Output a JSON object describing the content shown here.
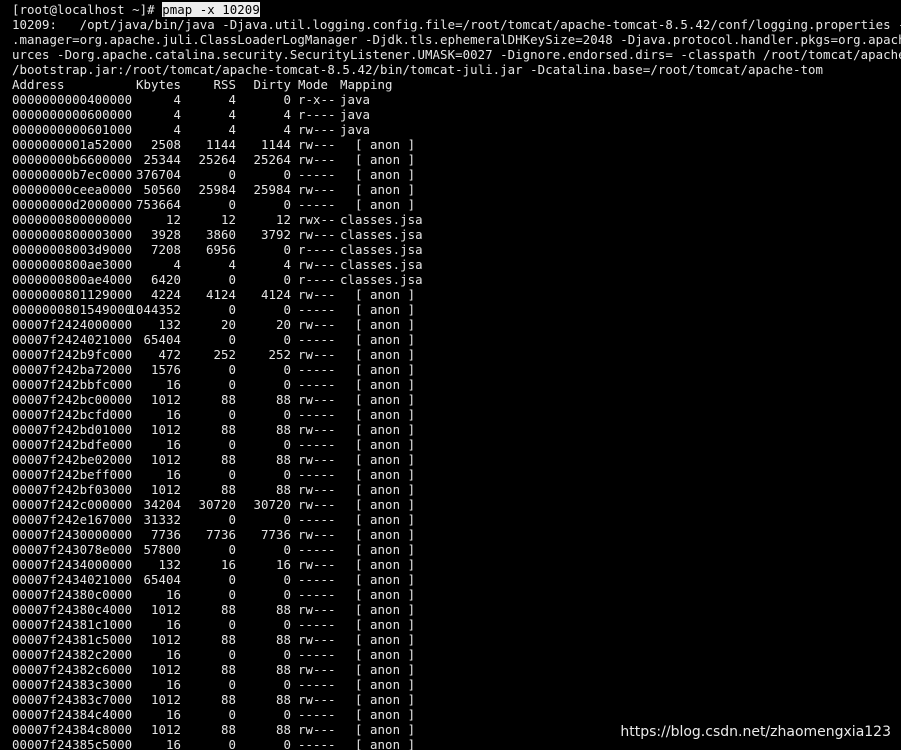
{
  "terminal": {
    "prompt": "[root@localhost ~]# ",
    "command": "pmap -x 10209",
    "info_lines": [
      "10209:   /opt/java/bin/java -Djava.util.logging.config.file=/root/tomcat/apache-tomcat-8.5.42/conf/logging.properties -Djava.ut",
      ".manager=org.apache.juli.ClassLoaderLogManager -Djdk.tls.ephemeralDHKeySize=2048 -Djava.protocol.handler.pkgs=org.apache.catali",
      "urces -Dorg.apache.catalina.security.SecurityListener.UMASK=0027 -Dignore.endorsed.dirs= -classpath /root/tomcat/apache-tomcat-",
      "/bootstrap.jar:/root/tomcat/apache-tomcat-8.5.42/bin/tomcat-juli.jar -Dcatalina.base=/root/tomcat/apache-tom"
    ],
    "headers": {
      "address": "Address",
      "kbytes": "Kbytes",
      "rss": "RSS",
      "dirty": "Dirty",
      "mode": "Mode",
      "mapping": "Mapping"
    },
    "rows": [
      {
        "address": "0000000000400000",
        "kbytes": "4",
        "rss": "4",
        "dirty": "0",
        "mode": "r-x--",
        "mapping": "java"
      },
      {
        "address": "0000000000600000",
        "kbytes": "4",
        "rss": "4",
        "dirty": "4",
        "mode": "r----",
        "mapping": "java"
      },
      {
        "address": "0000000000601000",
        "kbytes": "4",
        "rss": "4",
        "dirty": "4",
        "mode": "rw---",
        "mapping": "java"
      },
      {
        "address": "0000000001a52000",
        "kbytes": "2508",
        "rss": "1144",
        "dirty": "1144",
        "mode": "rw---",
        "mapping": "  [ anon ]"
      },
      {
        "address": "00000000b6600000",
        "kbytes": "25344",
        "rss": "25264",
        "dirty": "25264",
        "mode": "rw---",
        "mapping": "  [ anon ]"
      },
      {
        "address": "00000000b7ec0000",
        "kbytes": "376704",
        "rss": "0",
        "dirty": "0",
        "mode": "-----",
        "mapping": "  [ anon ]"
      },
      {
        "address": "00000000ceea0000",
        "kbytes": "50560",
        "rss": "25984",
        "dirty": "25984",
        "mode": "rw---",
        "mapping": "  [ anon ]"
      },
      {
        "address": "00000000d2000000",
        "kbytes": "753664",
        "rss": "0",
        "dirty": "0",
        "mode": "-----",
        "mapping": "  [ anon ]"
      },
      {
        "address": "0000000800000000",
        "kbytes": "12",
        "rss": "12",
        "dirty": "12",
        "mode": "rwx--",
        "mapping": "classes.jsa"
      },
      {
        "address": "0000000800003000",
        "kbytes": "3928",
        "rss": "3860",
        "dirty": "3792",
        "mode": "rw---",
        "mapping": "classes.jsa"
      },
      {
        "address": "00000008003d9000",
        "kbytes": "7208",
        "rss": "6956",
        "dirty": "0",
        "mode": "r----",
        "mapping": "classes.jsa"
      },
      {
        "address": "0000000800ae3000",
        "kbytes": "4",
        "rss": "4",
        "dirty": "4",
        "mode": "rw---",
        "mapping": "classes.jsa"
      },
      {
        "address": "0000000800ae4000",
        "kbytes": "6420",
        "rss": "0",
        "dirty": "0",
        "mode": "r----",
        "mapping": "classes.jsa"
      },
      {
        "address": "0000000801129000",
        "kbytes": "4224",
        "rss": "4124",
        "dirty": "4124",
        "mode": "rw---",
        "mapping": "  [ anon ]"
      },
      {
        "address": "0000000801549000",
        "kbytes": "1044352",
        "rss": "0",
        "dirty": "0",
        "mode": "-----",
        "mapping": "  [ anon ]"
      },
      {
        "address": "00007f2424000000",
        "kbytes": "132",
        "rss": "20",
        "dirty": "20",
        "mode": "rw---",
        "mapping": "  [ anon ]"
      },
      {
        "address": "00007f2424021000",
        "kbytes": "65404",
        "rss": "0",
        "dirty": "0",
        "mode": "-----",
        "mapping": "  [ anon ]"
      },
      {
        "address": "00007f242b9fc000",
        "kbytes": "472",
        "rss": "252",
        "dirty": "252",
        "mode": "rw---",
        "mapping": "  [ anon ]"
      },
      {
        "address": "00007f242ba72000",
        "kbytes": "1576",
        "rss": "0",
        "dirty": "0",
        "mode": "-----",
        "mapping": "  [ anon ]"
      },
      {
        "address": "00007f242bbfc000",
        "kbytes": "16",
        "rss": "0",
        "dirty": "0",
        "mode": "-----",
        "mapping": "  [ anon ]"
      },
      {
        "address": "00007f242bc00000",
        "kbytes": "1012",
        "rss": "88",
        "dirty": "88",
        "mode": "rw---",
        "mapping": "  [ anon ]"
      },
      {
        "address": "00007f242bcfd000",
        "kbytes": "16",
        "rss": "0",
        "dirty": "0",
        "mode": "-----",
        "mapping": "  [ anon ]"
      },
      {
        "address": "00007f242bd01000",
        "kbytes": "1012",
        "rss": "88",
        "dirty": "88",
        "mode": "rw---",
        "mapping": "  [ anon ]"
      },
      {
        "address": "00007f242bdfe000",
        "kbytes": "16",
        "rss": "0",
        "dirty": "0",
        "mode": "-----",
        "mapping": "  [ anon ]"
      },
      {
        "address": "00007f242be02000",
        "kbytes": "1012",
        "rss": "88",
        "dirty": "88",
        "mode": "rw---",
        "mapping": "  [ anon ]"
      },
      {
        "address": "00007f242beff000",
        "kbytes": "16",
        "rss": "0",
        "dirty": "0",
        "mode": "-----",
        "mapping": "  [ anon ]"
      },
      {
        "address": "00007f242bf03000",
        "kbytes": "1012",
        "rss": "88",
        "dirty": "88",
        "mode": "rw---",
        "mapping": "  [ anon ]"
      },
      {
        "address": "00007f242c000000",
        "kbytes": "34204",
        "rss": "30720",
        "dirty": "30720",
        "mode": "rw---",
        "mapping": "  [ anon ]"
      },
      {
        "address": "00007f242e167000",
        "kbytes": "31332",
        "rss": "0",
        "dirty": "0",
        "mode": "-----",
        "mapping": "  [ anon ]"
      },
      {
        "address": "00007f2430000000",
        "kbytes": "7736",
        "rss": "7736",
        "dirty": "7736",
        "mode": "rw---",
        "mapping": "  [ anon ]"
      },
      {
        "address": "00007f243078e000",
        "kbytes": "57800",
        "rss": "0",
        "dirty": "0",
        "mode": "-----",
        "mapping": "  [ anon ]"
      },
      {
        "address": "00007f2434000000",
        "kbytes": "132",
        "rss": "16",
        "dirty": "16",
        "mode": "rw---",
        "mapping": "  [ anon ]"
      },
      {
        "address": "00007f2434021000",
        "kbytes": "65404",
        "rss": "0",
        "dirty": "0",
        "mode": "-----",
        "mapping": "  [ anon ]"
      },
      {
        "address": "00007f24380c0000",
        "kbytes": "16",
        "rss": "0",
        "dirty": "0",
        "mode": "-----",
        "mapping": "  [ anon ]"
      },
      {
        "address": "00007f24380c4000",
        "kbytes": "1012",
        "rss": "88",
        "dirty": "88",
        "mode": "rw---",
        "mapping": "  [ anon ]"
      },
      {
        "address": "00007f24381c1000",
        "kbytes": "16",
        "rss": "0",
        "dirty": "0",
        "mode": "-----",
        "mapping": "  [ anon ]"
      },
      {
        "address": "00007f24381c5000",
        "kbytes": "1012",
        "rss": "88",
        "dirty": "88",
        "mode": "rw---",
        "mapping": "  [ anon ]"
      },
      {
        "address": "00007f24382c2000",
        "kbytes": "16",
        "rss": "0",
        "dirty": "0",
        "mode": "-----",
        "mapping": "  [ anon ]"
      },
      {
        "address": "00007f24382c6000",
        "kbytes": "1012",
        "rss": "88",
        "dirty": "88",
        "mode": "rw---",
        "mapping": "  [ anon ]"
      },
      {
        "address": "00007f24383c3000",
        "kbytes": "16",
        "rss": "0",
        "dirty": "0",
        "mode": "-----",
        "mapping": "  [ anon ]"
      },
      {
        "address": "00007f24383c7000",
        "kbytes": "1012",
        "rss": "88",
        "dirty": "88",
        "mode": "rw---",
        "mapping": "  [ anon ]"
      },
      {
        "address": "00007f24384c4000",
        "kbytes": "16",
        "rss": "0",
        "dirty": "0",
        "mode": "-----",
        "mapping": "  [ anon ]"
      },
      {
        "address": "00007f24384c8000",
        "kbytes": "1012",
        "rss": "88",
        "dirty": "88",
        "mode": "rw---",
        "mapping": "  [ anon ]"
      },
      {
        "address": "00007f24385c5000",
        "kbytes": "16",
        "rss": "0",
        "dirty": "0",
        "mode": "-----",
        "mapping": "  [ anon ]"
      }
    ]
  },
  "watermark": "https://blog.csdn.net/zhaomengxia123",
  "colors": {
    "background": "#000000",
    "text": "#e6e6e6",
    "command_highlight": "#ededed"
  }
}
